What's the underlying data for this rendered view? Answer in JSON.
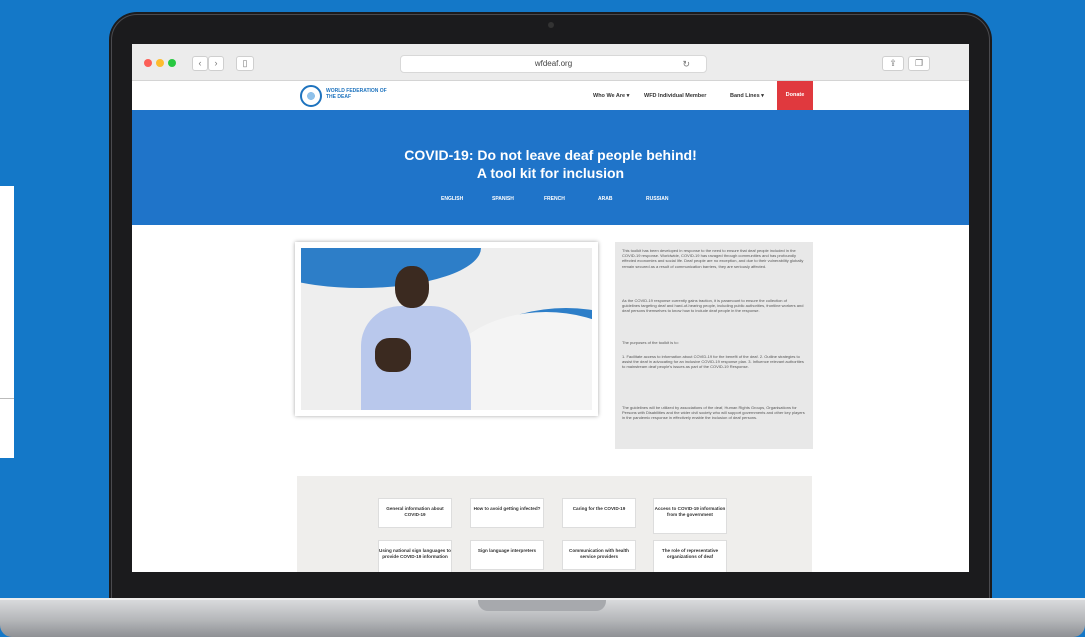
{
  "browser": {
    "url": "wfdeaf.org",
    "back_icon": "chevron-left-icon",
    "forward_icon": "chevron-right-icon",
    "sidebar_icon": "sidebar-icon",
    "reload_icon": "reload-icon",
    "share_icon": "share-icon",
    "tabs_icon": "tabs-icon"
  },
  "site": {
    "logo_text": "WORLD FEDERATION OF THE DEAF",
    "nav": [
      "Who We Are ▾",
      "WFD Individual Member",
      "Band Lines ▾"
    ],
    "donate": "Donate"
  },
  "banner": {
    "title_line1": "COVID-19: Do not leave deaf people behind!",
    "title_line2": "A tool kit for inclusion",
    "languages": [
      "ENGLISH",
      "SPANISH",
      "FRENCH",
      "ARAB",
      "RUSSIAN"
    ]
  },
  "intro": {
    "p1": "This toolkit has been developed in response to the need to ensure that deaf people included in the COVID-19 response. Worldwide, COVID-19 has ravaged through communities and has profoundly effected economies and social life. Deaf people are no exception, and due to their vulnerability globally remain secured as a result of communication barriers, they are seriously affected.",
    "p2": "As the COVID-19 response currently gains traction, it is paramount to ensure the collection of guidelines targeting deaf and hard-of-hearing people, including public authorities, frontline workers and deaf persons themselves to know how to include deaf people in the response.",
    "p3": "The purposes of the toolkit is to:",
    "p4": "1. Facilitate access to information about COVID-19 for the benefit of the deaf. 2. Outline strategies to assist the deaf in advocating for an inclusive COVID-19 response plan. 3. Influence relevant authorities to mainstream deaf people's issues as part of the COVID-19 Response.",
    "p5": "The guidelines will be utilized by associations of the deaf, Human Rights Groups, Organisations for Persons with Disabilities and the wider civil society who will support governments and other key players in the pandemic response in effectively enable the inclusion of deaf persons."
  },
  "cards": [
    "General information about COVID-19",
    "How to avoid getting infected?",
    "Caring for the COVID-19",
    "Access to COVID-19 information from the government",
    "Using national sign languages to provide COVID-19 information",
    "Sign language interpreters",
    "Communication with health service providers",
    "The role of representative organizations of deaf"
  ]
}
